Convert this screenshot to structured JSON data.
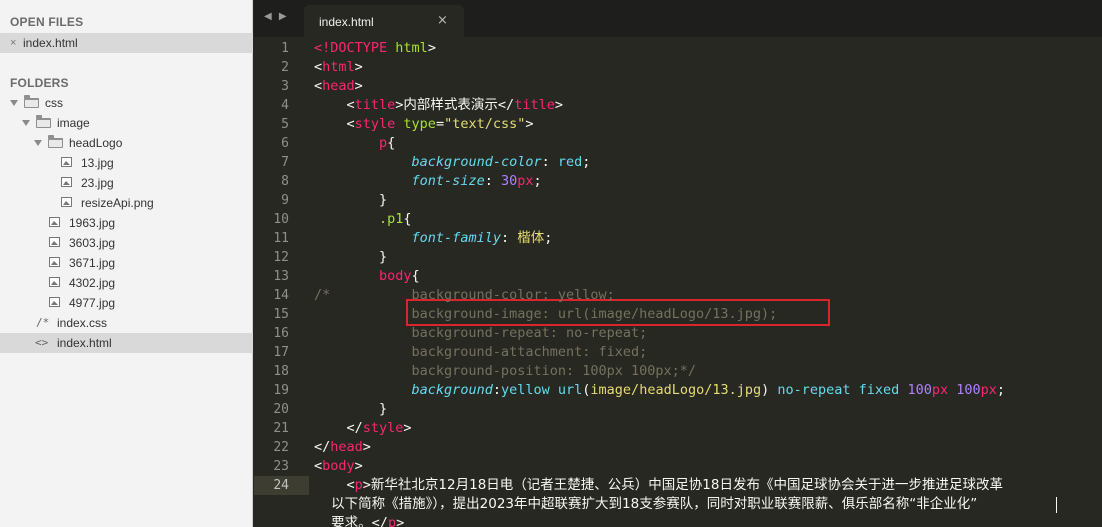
{
  "sidebar": {
    "open_files_title": "OPEN FILES",
    "open_files": [
      {
        "label": "index.html",
        "selected": true
      }
    ],
    "folders_title": "FOLDERS",
    "tree": [
      {
        "label": "css",
        "type": "folder",
        "depth": 0
      },
      {
        "label": "image",
        "type": "folder",
        "depth": 1
      },
      {
        "label": "headLogo",
        "type": "folder",
        "depth": 2
      },
      {
        "label": "13.jpg",
        "type": "image",
        "depth": 3
      },
      {
        "label": "23.jpg",
        "type": "image",
        "depth": 3
      },
      {
        "label": "resizeApi.png",
        "type": "image",
        "depth": 3
      },
      {
        "label": "1963.jpg",
        "type": "image",
        "depth": 2
      },
      {
        "label": "3603.jpg",
        "type": "image",
        "depth": 2
      },
      {
        "label": "3671.jpg",
        "type": "image",
        "depth": 2
      },
      {
        "label": "4302.jpg",
        "type": "image",
        "depth": 2
      },
      {
        "label": "4977.jpg",
        "type": "image",
        "depth": 2
      },
      {
        "label": "index.css",
        "type": "css",
        "depth": 1
      },
      {
        "label": "index.html",
        "type": "html",
        "depth": 1,
        "selected": true
      }
    ]
  },
  "tabbar": {
    "nav_arrows": "◀ ▶",
    "tabs": [
      {
        "label": "index.html",
        "close": "×",
        "active": true
      }
    ]
  },
  "editor": {
    "current_line": 24,
    "line_numbers": [
      "1",
      "2",
      "3",
      "4",
      "5",
      "6",
      "7",
      "8",
      "9",
      "10",
      "11",
      "12",
      "13",
      "14",
      "15",
      "16",
      "17",
      "18",
      "19",
      "20",
      "21",
      "22",
      "23",
      "24"
    ],
    "lines": [
      [
        [
          "t",
          "<!DOCTYPE"
        ],
        [
          "w",
          " "
        ],
        [
          "a",
          "html"
        ],
        [
          "w",
          ">"
        ]
      ],
      [
        [
          "w",
          "<"
        ],
        [
          "t",
          "html"
        ],
        [
          "w",
          ">"
        ]
      ],
      [
        [
          "w",
          "<"
        ],
        [
          "t",
          "head"
        ],
        [
          "w",
          ">"
        ]
      ],
      [
        [
          "w",
          "    <"
        ],
        [
          "t",
          "title"
        ],
        [
          "w",
          ">"
        ],
        [
          "zh",
          "内部样式表演示"
        ],
        [
          "w",
          "</"
        ],
        [
          "t",
          "title"
        ],
        [
          "w",
          ">"
        ]
      ],
      [
        [
          "w",
          "    <"
        ],
        [
          "t",
          "style"
        ],
        [
          "w",
          " "
        ],
        [
          "a",
          "type"
        ],
        [
          "w",
          "="
        ],
        [
          "s",
          "\"text/css\""
        ],
        [
          "w",
          ">"
        ]
      ],
      [
        [
          "w",
          "        "
        ],
        [
          "t",
          "p"
        ],
        [
          "w",
          "{"
        ]
      ],
      [
        [
          "w",
          "            "
        ],
        [
          "p",
          "background-color"
        ],
        [
          "w",
          ": "
        ],
        [
          "v",
          "red"
        ],
        [
          "w",
          ";"
        ]
      ],
      [
        [
          "w",
          "            "
        ],
        [
          "p",
          "font-size"
        ],
        [
          "w",
          ": "
        ],
        [
          "n",
          "30"
        ],
        [
          "t",
          "px"
        ],
        [
          "w",
          ";"
        ]
      ],
      [
        [
          "w",
          "        }"
        ]
      ],
      [
        [
          "w",
          "        "
        ],
        [
          "a",
          ".p1"
        ],
        [
          "w",
          "{"
        ]
      ],
      [
        [
          "w",
          "            "
        ],
        [
          "p",
          "font-family"
        ],
        [
          "w",
          ": "
        ],
        [
          "szh",
          "楷体"
        ],
        [
          "w",
          ";"
        ]
      ],
      [
        [
          "w",
          "        }"
        ]
      ],
      [
        [
          "w",
          "        "
        ],
        [
          "t",
          "body"
        ],
        [
          "w",
          "{"
        ]
      ],
      [
        [
          "c",
          "/*          background-color: yellow;"
        ]
      ],
      [
        [
          "c",
          "            background-image: url(image/headLogo/13.jpg);"
        ]
      ],
      [
        [
          "c",
          "            background-repeat: no-repeat;"
        ]
      ],
      [
        [
          "c",
          "            background-attachment: fixed;"
        ]
      ],
      [
        [
          "c",
          "            background-position: 100px 100px;*/"
        ]
      ],
      [
        [
          "w",
          "            "
        ],
        [
          "p",
          "background"
        ],
        [
          "w",
          ":"
        ],
        [
          "v",
          "yellow"
        ],
        [
          "w",
          " "
        ],
        [
          "v",
          "url"
        ],
        [
          "w",
          "("
        ],
        [
          "s",
          "image/headLogo/13.jpg"
        ],
        [
          "w",
          ") "
        ],
        [
          "v",
          "no-repeat"
        ],
        [
          "w",
          " "
        ],
        [
          "v",
          "fixed"
        ],
        [
          "w",
          " "
        ],
        [
          "n",
          "100"
        ],
        [
          "t",
          "px"
        ],
        [
          "w",
          " "
        ],
        [
          "n",
          "100"
        ],
        [
          "t",
          "px"
        ],
        [
          "w",
          ";"
        ]
      ],
      [
        [
          "w",
          "        }"
        ]
      ],
      [
        [
          "w",
          "    </"
        ],
        [
          "t",
          "style"
        ],
        [
          "w",
          ">"
        ]
      ],
      [
        [
          "w",
          "</"
        ],
        [
          "t",
          "head"
        ],
        [
          "w",
          ">"
        ]
      ],
      [
        [
          "w",
          "<"
        ],
        [
          "t",
          "body"
        ],
        [
          "w",
          ">"
        ]
      ],
      [
        [
          "w",
          "    <"
        ],
        [
          "t",
          "p"
        ],
        [
          "w",
          ">"
        ],
        [
          "zh",
          "新华社北京12月18日电（记者王楚捷、公兵）中国足协18日发布《中国足球协会关于进一步推进足球改革"
        ]
      ]
    ],
    "wrap_lines": [
      [
        [
          "zh",
          "    以下简称《措施》），提出2023年中超联赛扩大到18支参赛队，同时对职业联赛限薪、俱乐部名称“非企业化”"
        ]
      ],
      [
        [
          "zh",
          "    要求。"
        ],
        [
          "w",
          "</"
        ],
        [
          "t",
          "p"
        ],
        [
          "w",
          ">"
        ]
      ]
    ]
  },
  "colors": {
    "editor_bg": "#272822",
    "tag": "#f92672",
    "attribute": "#a6e22e",
    "string": "#e6db74",
    "number": "#ae81ff",
    "property": "#66d9ef",
    "comment": "#75715e",
    "highlight_box": "#d9262c"
  }
}
